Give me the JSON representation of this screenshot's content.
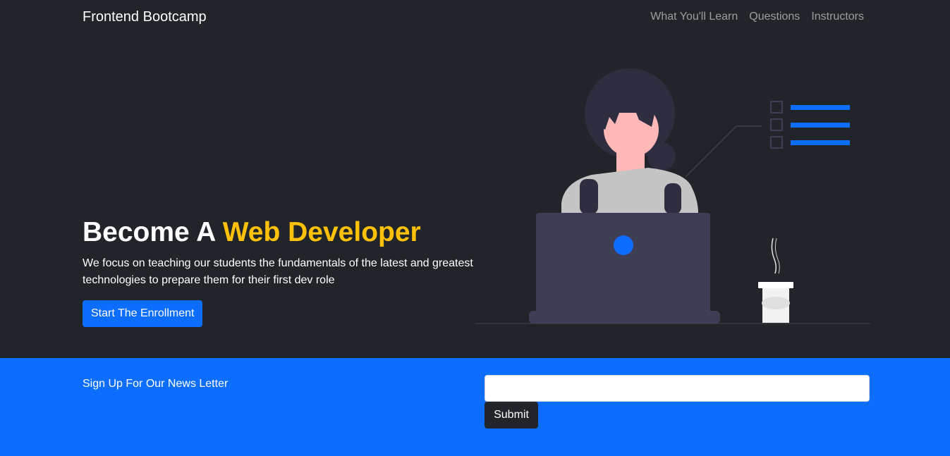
{
  "nav": {
    "brand": "Frontend Bootcamp",
    "links": [
      {
        "label": "What You'll Learn"
      },
      {
        "label": "Questions"
      },
      {
        "label": "Instructors"
      }
    ]
  },
  "hero": {
    "title_prefix": "Become A",
    "title_accent": "Web Developer",
    "description": "We focus on teaching our students the fundamentals of the latest and greatest technologies to prepare them for their first dev role",
    "button_label": "Start The Enrollment",
    "illustration": "woman-at-laptop-illustration"
  },
  "newsletter": {
    "label": "Sign Up For Our News Letter",
    "input_value": "",
    "input_placeholder": "",
    "submit_label": "Submit"
  },
  "colors": {
    "background": "#212529",
    "accent": "#ffc107",
    "primary": "#0d6efd",
    "text": "#ffffff"
  }
}
